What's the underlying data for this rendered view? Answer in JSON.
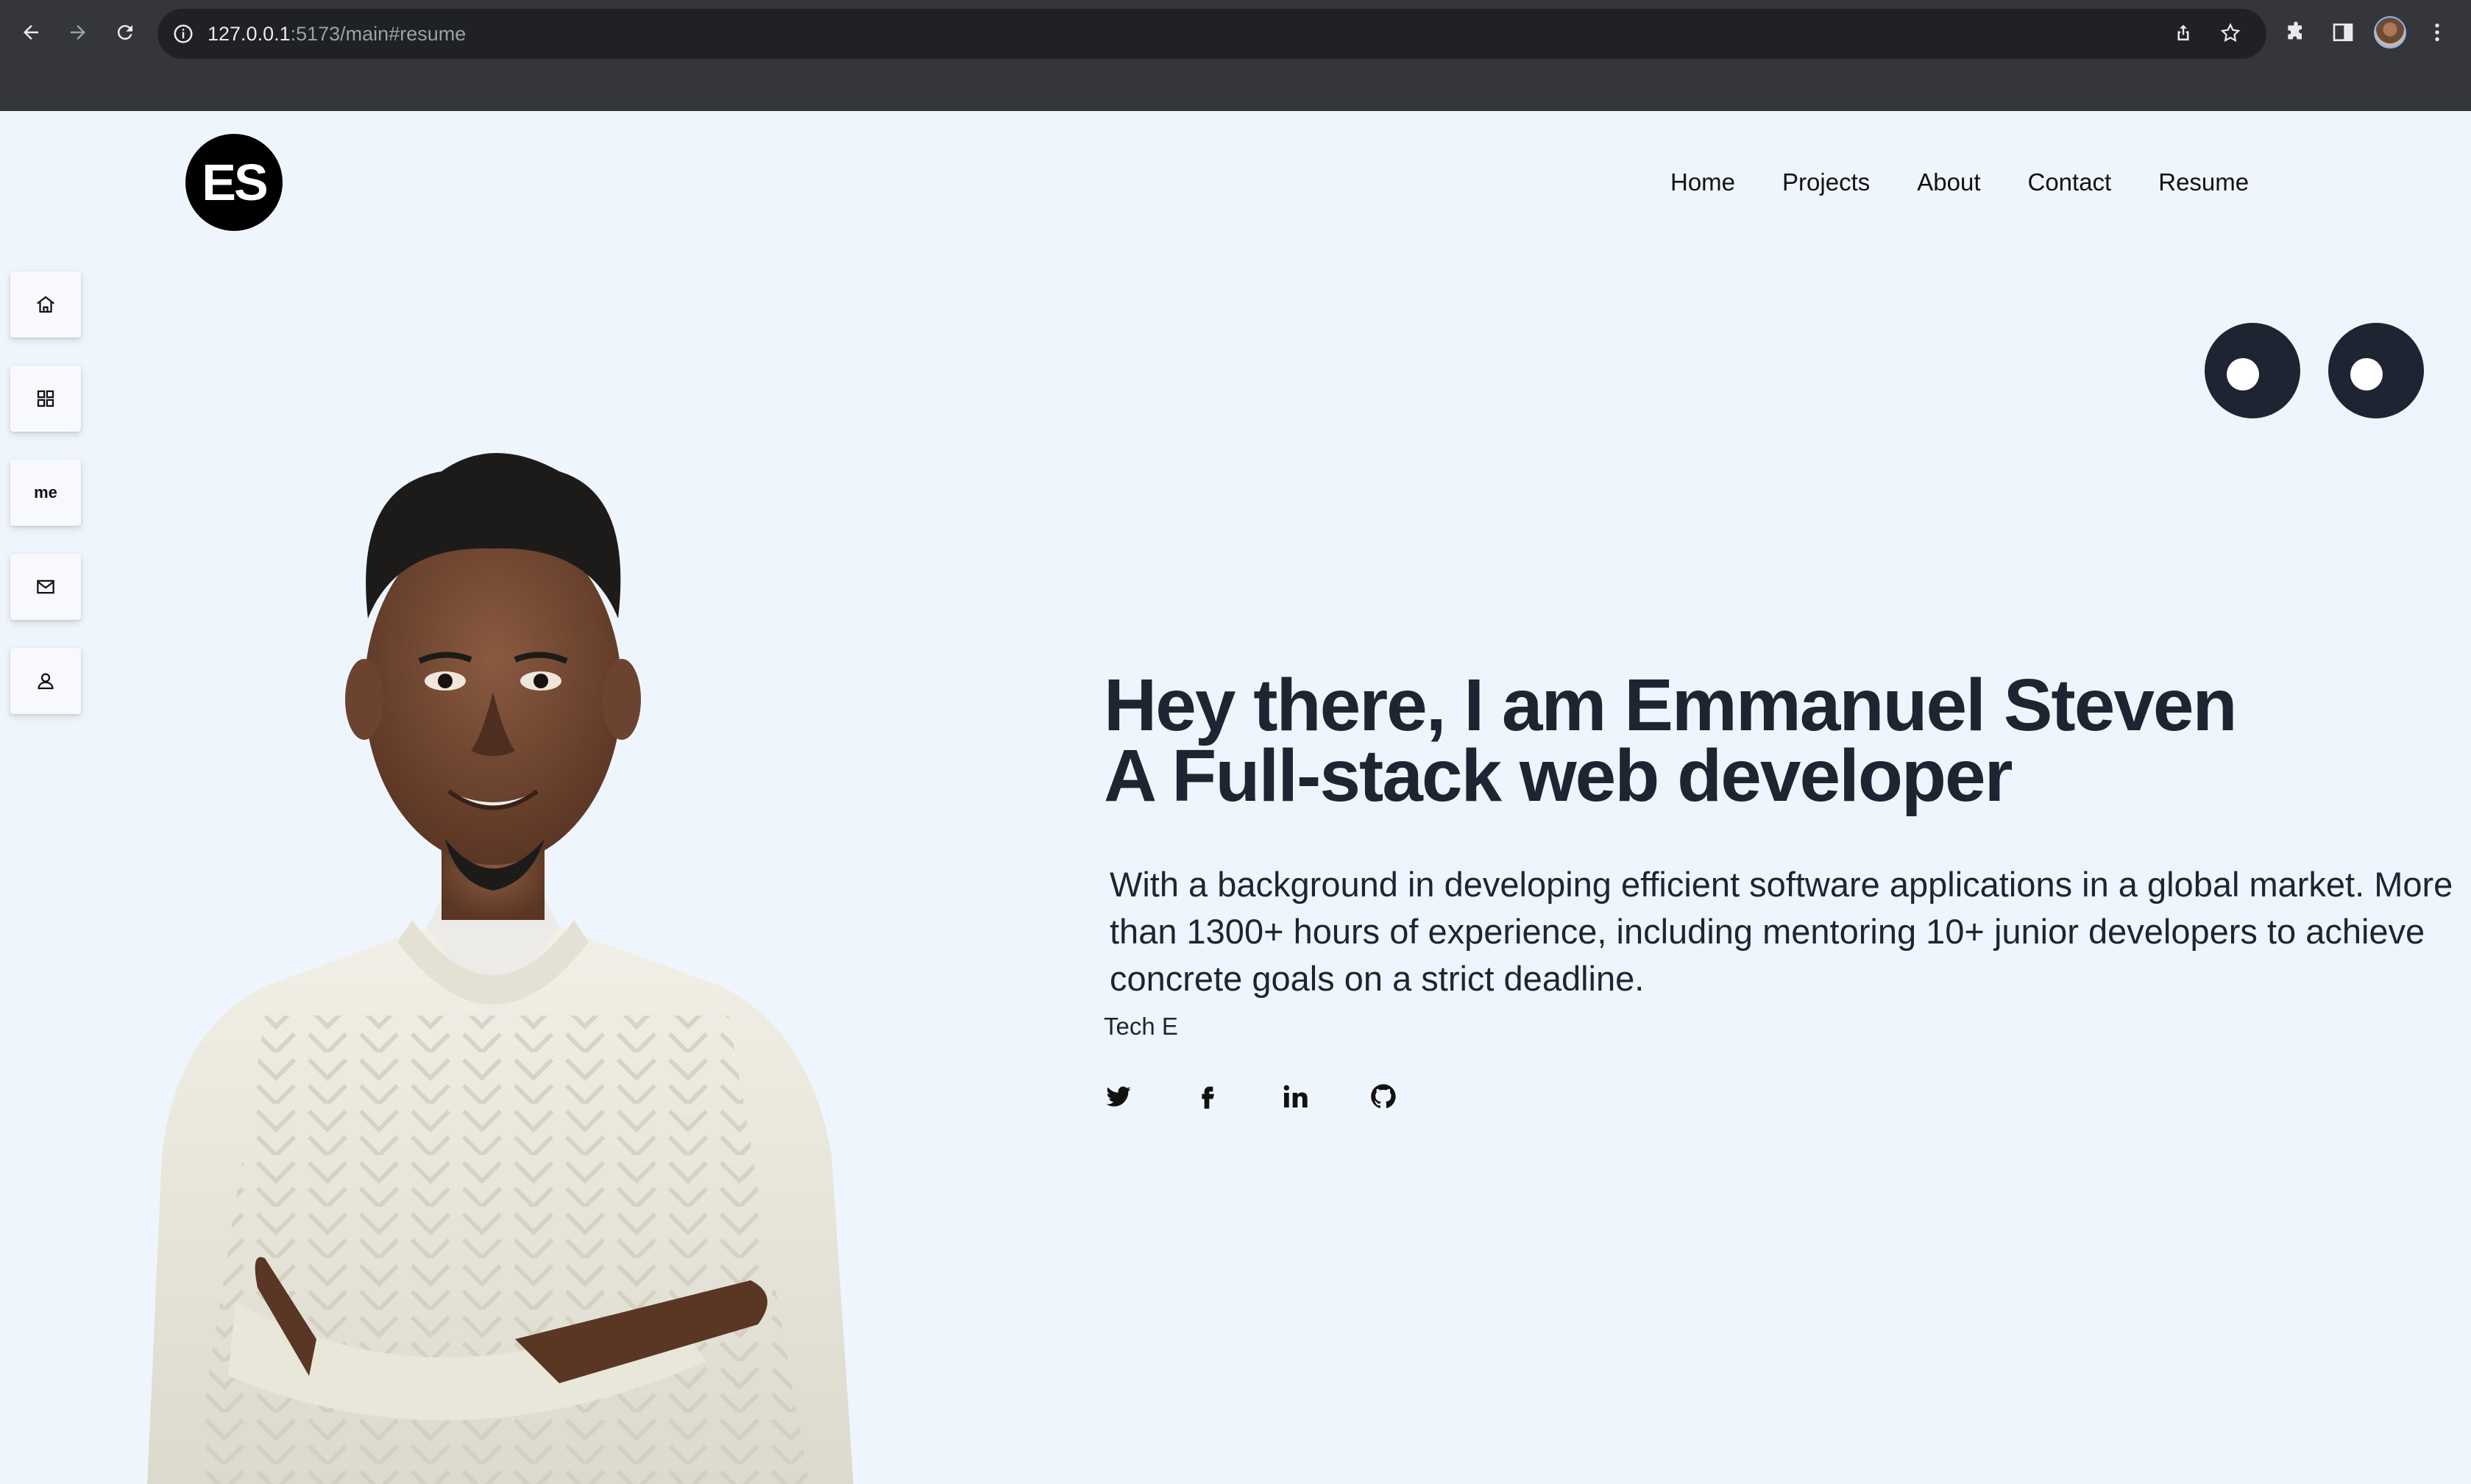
{
  "browser": {
    "url_host": "127.0.0.1",
    "url_path": ":5173/main#resume"
  },
  "header": {
    "logo_text": "ES",
    "nav": [
      {
        "label": "Home"
      },
      {
        "label": "Projects"
      },
      {
        "label": "About"
      },
      {
        "label": "Contact"
      },
      {
        "label": "Resume"
      }
    ]
  },
  "side_nav": {
    "items": [
      {
        "icon": "home-icon"
      },
      {
        "icon": "grid-icon"
      },
      {
        "icon": "me-text",
        "label": "me"
      },
      {
        "icon": "mail-icon"
      },
      {
        "icon": "user-icon"
      }
    ]
  },
  "hero": {
    "headline_line1": "Hey there, I am Emmanuel Steven",
    "headline_line2": "A Full-stack web developer",
    "bio": "With a background in developing efficient software applications in a global market. More than 1300+ hours of experience, including mentoring 10+ junior developers to achieve concrete goals on a strict deadline.",
    "tag": "Tech E",
    "socials": [
      "twitter-icon",
      "facebook-icon",
      "linkedin-icon",
      "github-icon"
    ]
  },
  "colors": {
    "page_bg": "#eff5fc",
    "text_dark": "#1f2433",
    "chrome_bg": "#35363a",
    "omnibox_bg": "#202124"
  }
}
